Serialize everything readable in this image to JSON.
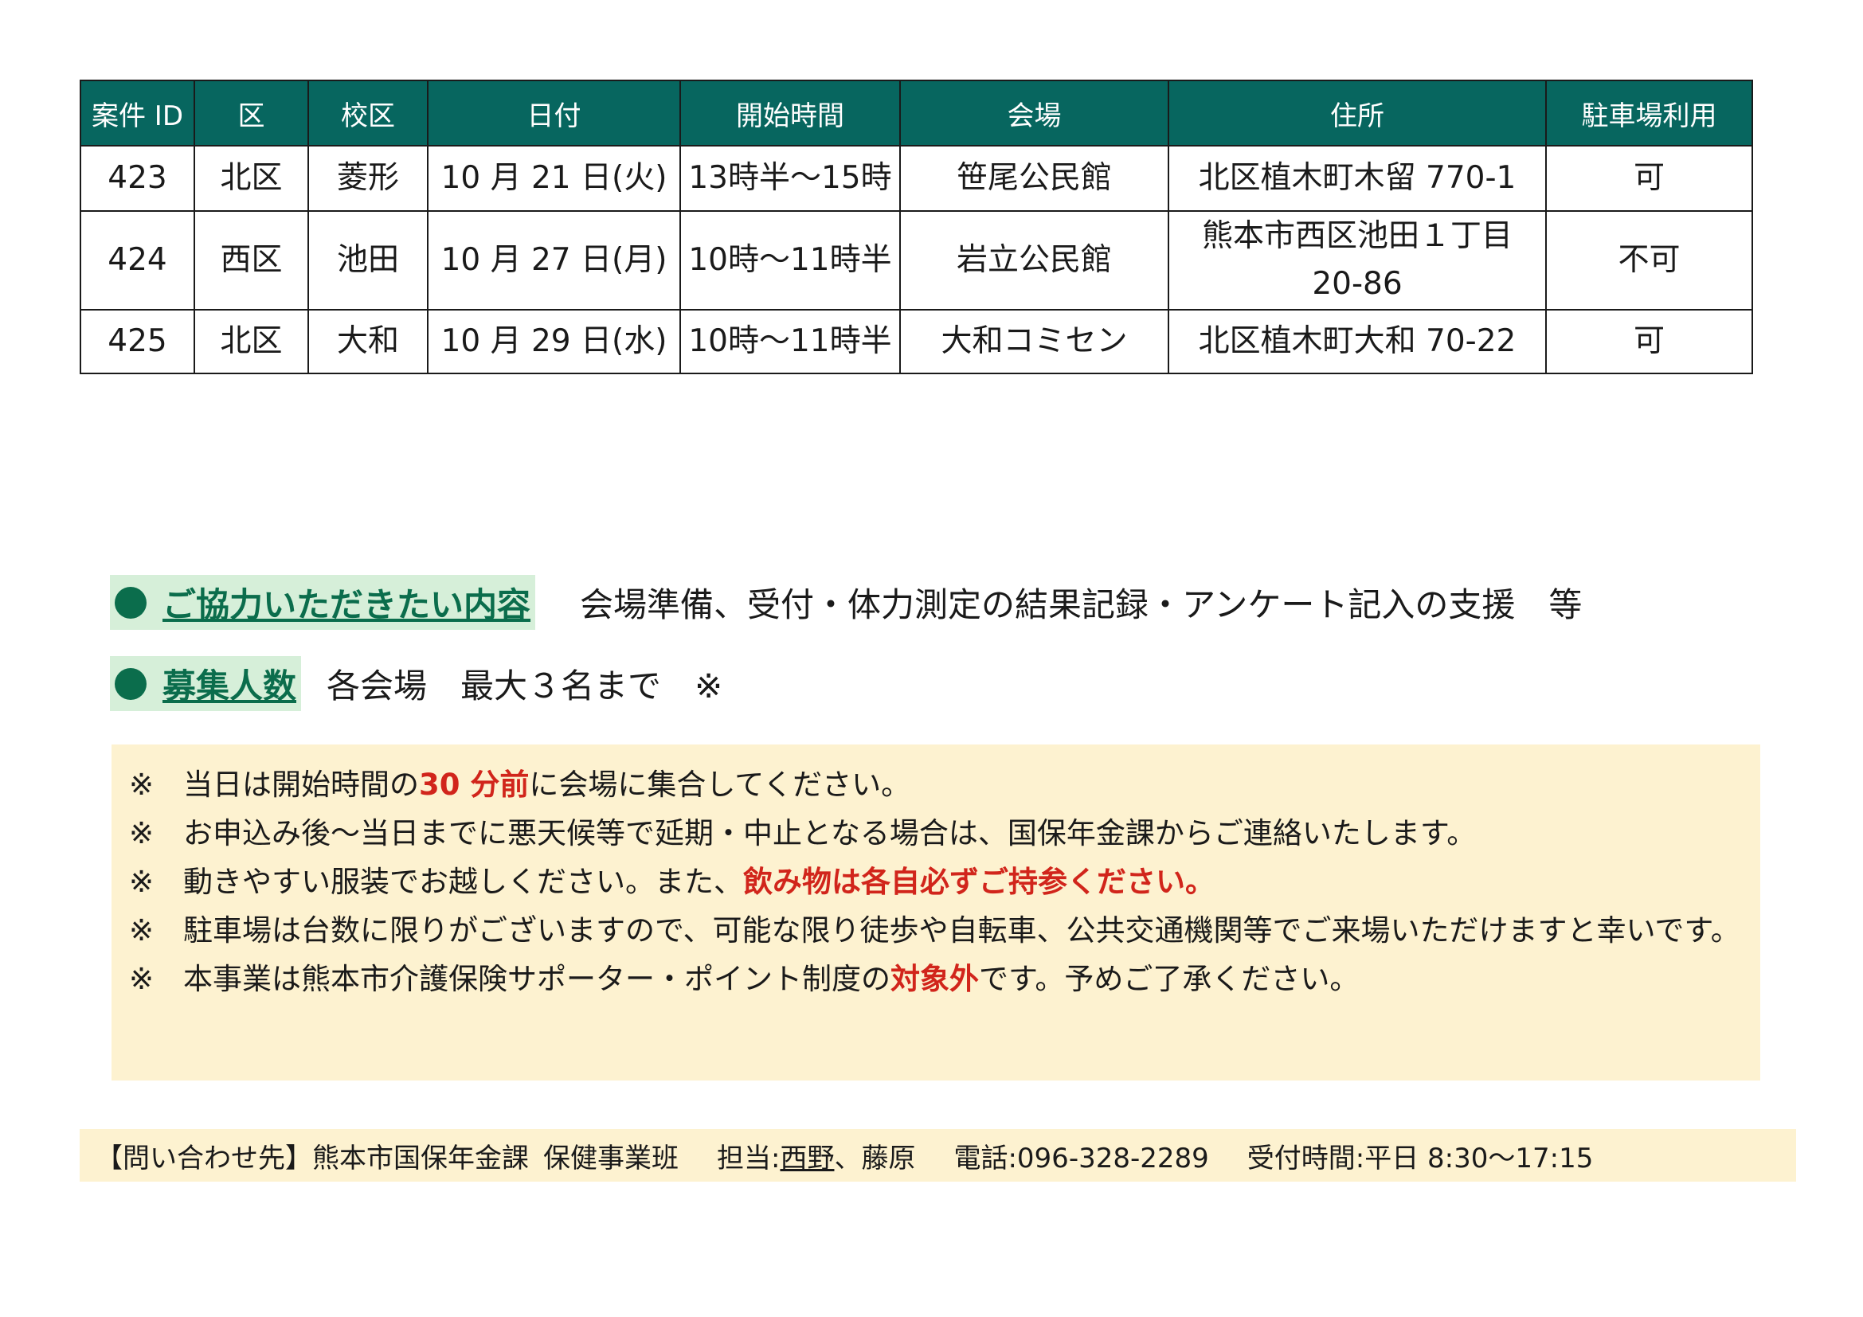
{
  "table": {
    "headers": [
      "案件 ID",
      "区",
      "校区",
      "日付",
      "開始時間",
      "会場",
      "住所",
      "駐車場利用"
    ],
    "rows": [
      {
        "id": "423",
        "ward": "北区",
        "school": "菱形",
        "date": "10 月 21 日(火)",
        "time": "13時半～15時",
        "venue": "笹尾公民館",
        "address_line1": "北区植木町木留 770-1",
        "address_line2": "",
        "parking": "可"
      },
      {
        "id": "424",
        "ward": "西区",
        "school": "池田",
        "date": "10 月 27 日(月)",
        "time": "10時～11時半",
        "venue": "岩立公民館",
        "address_line1": "熊本市西区池田１丁目",
        "address_line2": "20-86",
        "parking": "不可"
      },
      {
        "id": "425",
        "ward": "北区",
        "school": "大和",
        "date": "10 月 29 日(水)",
        "time": "10時～11時半",
        "venue": "大和コミセン",
        "address_line1": "北区植木町大和 70-22",
        "address_line2": "",
        "parking": "可"
      }
    ]
  },
  "cooperation": {
    "heading": "ご協力いただきたい内容",
    "body": "会場準備、受付・体力測定の結果記録・アンケート記入の支援　等"
  },
  "recruitment": {
    "heading": "募集人数",
    "body": "各会場　最大３名まで　※"
  },
  "notes": {
    "n1_pre": "※　当日は開始時間の",
    "n1_red": "30 分前",
    "n1_post": "に会場に集合してください。",
    "n2": "※　お申込み後～当日までに悪天候等で延期・中止となる場合は、国保年金課からご連絡いたします。",
    "n3_pre": "※　動きやすい服装でお越しください。また、",
    "n3_red": "飲み物は各自必ずご持参ください。",
    "n4": "※　駐車場は台数に限りがございますので、可能な限り徒歩や自転車、公共交通機関等でご来場いただけますと幸いです。",
    "n5_pre": "※　本事業は熊本市介護保険サポーター・ポイント制度の",
    "n5_red": "対象外",
    "n5_post": "です。予めご了承ください。"
  },
  "contact": {
    "label": "【問い合わせ先】熊本市国保年金課",
    "team": "保健事業班",
    "staff_label": "担当:",
    "staff_1": "西野",
    "staff_2": "、藤原",
    "phone": "電話:096-328-2289",
    "hours": "受付時間:平日 8:30～17:15"
  },
  "colors": {
    "header_bg": "#07665f",
    "heading_green": "#0b6d4c",
    "heading_bg": "#d6efd9",
    "note_bg": "#fdf2d0",
    "emphasis_red": "#d1251b"
  }
}
